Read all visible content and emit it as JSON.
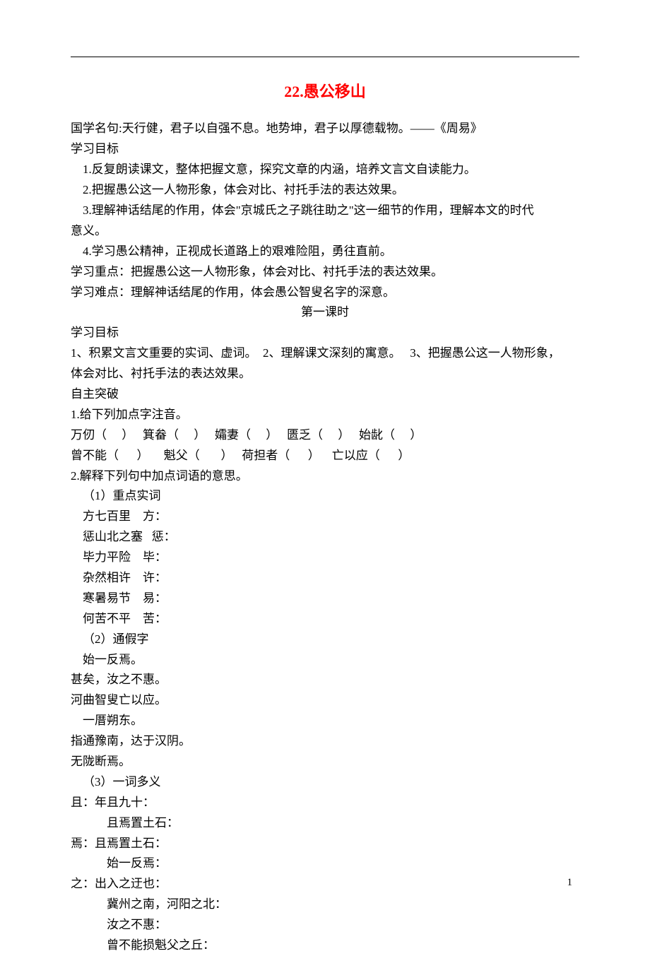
{
  "title": "22.愚公移山",
  "quote": "国学名句:天行健，君子以自强不息。地势坤，君子以厚德载物。——《周易》",
  "goals_heading": "学习目标",
  "goals": [
    "1.反复朗读课文，整体把握文意，探究文章的内涵，培养文言文自读能力。",
    "2.把握愚公这一人物形象，体会对比、衬托手法的表达效果。",
    "3.理解神话结尾的作用，体会\"京城氏之子跳往助之\"这一细节的作用，理解本文的时代",
    "意义。",
    "4.学习愚公精神，正视成长道路上的艰难险阻，勇往直前。"
  ],
  "key_point_label": "学习重点：",
  "key_point": "把握愚公这一人物形象，体会对比、衬托手法的表达效果。",
  "difficult_point_label": "学习难点：",
  "difficult_point": "理解神话结尾的作用，体会愚公智叟名字的深意。",
  "lesson_heading": "第一课时",
  "goals2_heading": "学习目标",
  "goals2_line1": "1、积累文言文重要的实词、虚词。  2、理解课文深刻的寓意。   3、把握愚公这一人物形象，",
  "goals2_line2": "体会对比、衬托手法的表达效果。",
  "breakthrough": "自主突破",
  "q1": "1.给下列加点字注音。",
  "q1_line1": "万仞（     ）   箕畚（     ）   孀妻（     ）   匮乏（     ）   始龀（     ）",
  "q1_line2": "曾不能（      ）     魁父（       ）   荷担者（      ）    亡以应（      ）",
  "q2": "2.解释下列句中加点词语的意思。",
  "q2_s1": "（1）重点实词",
  "q2_s1_items": [
    "方七百里    方：",
    "惩山北之塞   惩：",
    "毕力平险    毕：",
    "杂然相许    许：",
    "寒暑易节    易：",
    "何苦不平    苦："
  ],
  "q2_s2": "（2）通假字",
  "q2_s2_items": [
    "始一反焉。",
    "甚矣，汝之不惠。",
    "河曲智叟亡以应。",
    "一厝朔东。",
    "指通豫南，达于汉阴。",
    "无陇断焉。"
  ],
  "q2_s3": "（3）一词多义",
  "q2_s3_groups": [
    {
      "head": "且：",
      "items": [
        "年且九十：",
        "且焉置土石："
      ]
    },
    {
      "head": "焉：",
      "items": [
        "且焉置土石：",
        "始一反焉："
      ]
    },
    {
      "head": "之：",
      "items": [
        "出入之迂也：",
        "冀州之南，河阳之北：",
        "汝之不惠：",
        "曾不能损魁父之丘："
      ]
    }
  ],
  "pagenum": "1"
}
